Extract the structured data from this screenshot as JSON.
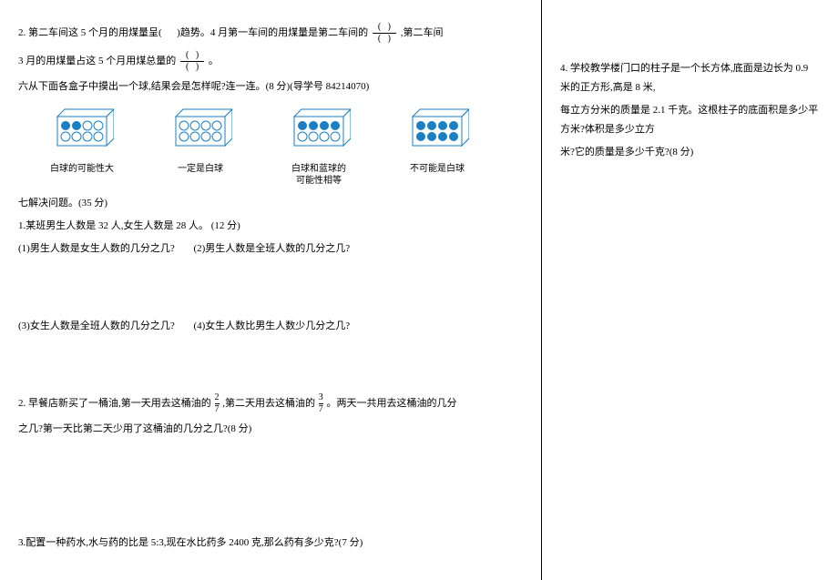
{
  "left": {
    "q2_line1_a": "2. 第二车间这 5 个月的用煤量呈(",
    "q2_line1_b": ")趋势。4 月第一车间的用煤量是第二车间的",
    "q2_line1_c": ",第二车间",
    "q2_line2_a": "3 月的用煤量占这 5 个月用煤总量的",
    "q2_line2_b": "。",
    "q6_title": "六从下面各盒子中摸出一个球,结果会是怎样呢?连一连。(8 分)(导学号   84214070)",
    "box_labels": {
      "b1": "白球的可能性大",
      "b2": "一定是白球",
      "b3": "白球和蓝球的\n可能性相等",
      "b4": "不可能是白球"
    },
    "q7_title": "七解决问题。(35 分)",
    "q7_1_main": "1.某班男生人数是 32 人,女生人数是 28 人。 (12 分)",
    "q7_1_sub1": "(1)男生人数是女生人数的几分之几?",
    "q7_1_sub2": "(2)男生人数是全班人数的几分之几?",
    "q7_1_sub3": "(3)女生人数是全班人数的几分之几?",
    "q7_1_sub4": "(4)女生人数比男生人数少几分之几?",
    "q7_2_a": "2. 早餐店新买了一桶油,第一天用去这桶油的",
    "q7_2_frac1_n": "2",
    "q7_2_frac1_d": "7",
    "q7_2_b": ",第二天用去这桶油的",
    "q7_2_frac2_n": "3",
    "q7_2_frac2_d": "7",
    "q7_2_c": "。两天一共用去这桶油的几分",
    "q7_2_line2": "之几?第一天比第二天少用了这桶油的几分之几?(8 分)",
    "q7_3": "3.配置一种药水,水与药的比是 5:3,现在水比药多 2400 克,那么药有多少克?(7 分)"
  },
  "right": {
    "q4_line1": "4. 学校教学楼门口的柱子是一个长方体,底面是边长为 0.9 米的正方形,高是 8 米,",
    "q4_line2": "每立方分米的质量是 2.1 千克。这根柱子的底面积是多少平方米?体积是多少立方",
    "q4_line3": "米?它的质量是多少千克?(8 分)"
  }
}
